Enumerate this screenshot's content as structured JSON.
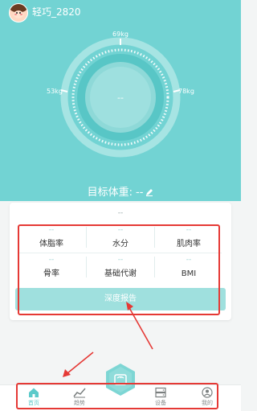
{
  "user": {
    "name": "轻巧_2820"
  },
  "gauge": {
    "value": "--",
    "ticks": {
      "top": "69kg",
      "left": "53kg",
      "right": "78kg"
    }
  },
  "target_weight": {
    "label": "目标体重:",
    "value": "--"
  },
  "card": {
    "top_value": "--",
    "metrics": [
      {
        "label": "体脂率",
        "value": "--"
      },
      {
        "label": "水分",
        "value": "--"
      },
      {
        "label": "肌肉率",
        "value": "--"
      },
      {
        "label": "骨率",
        "value": "--"
      },
      {
        "label": "基础代谢",
        "value": "--"
      },
      {
        "label": "BMI",
        "value": "--"
      }
    ],
    "report_button": "深度报告"
  },
  "tabbar": {
    "tabs": [
      {
        "label": "首页",
        "icon": "home-icon",
        "active": true
      },
      {
        "label": "趋势",
        "icon": "trend-icon",
        "active": false
      },
      {
        "label": "设备",
        "icon": "device-icon",
        "active": false
      },
      {
        "label": "我的",
        "icon": "user-icon",
        "active": false
      }
    ],
    "center_icon": "scale-icon"
  },
  "colors": {
    "primary": "#72d3d3",
    "accent": "#5ccaca",
    "button": "#9fe0de",
    "annotation": "#e53935"
  }
}
